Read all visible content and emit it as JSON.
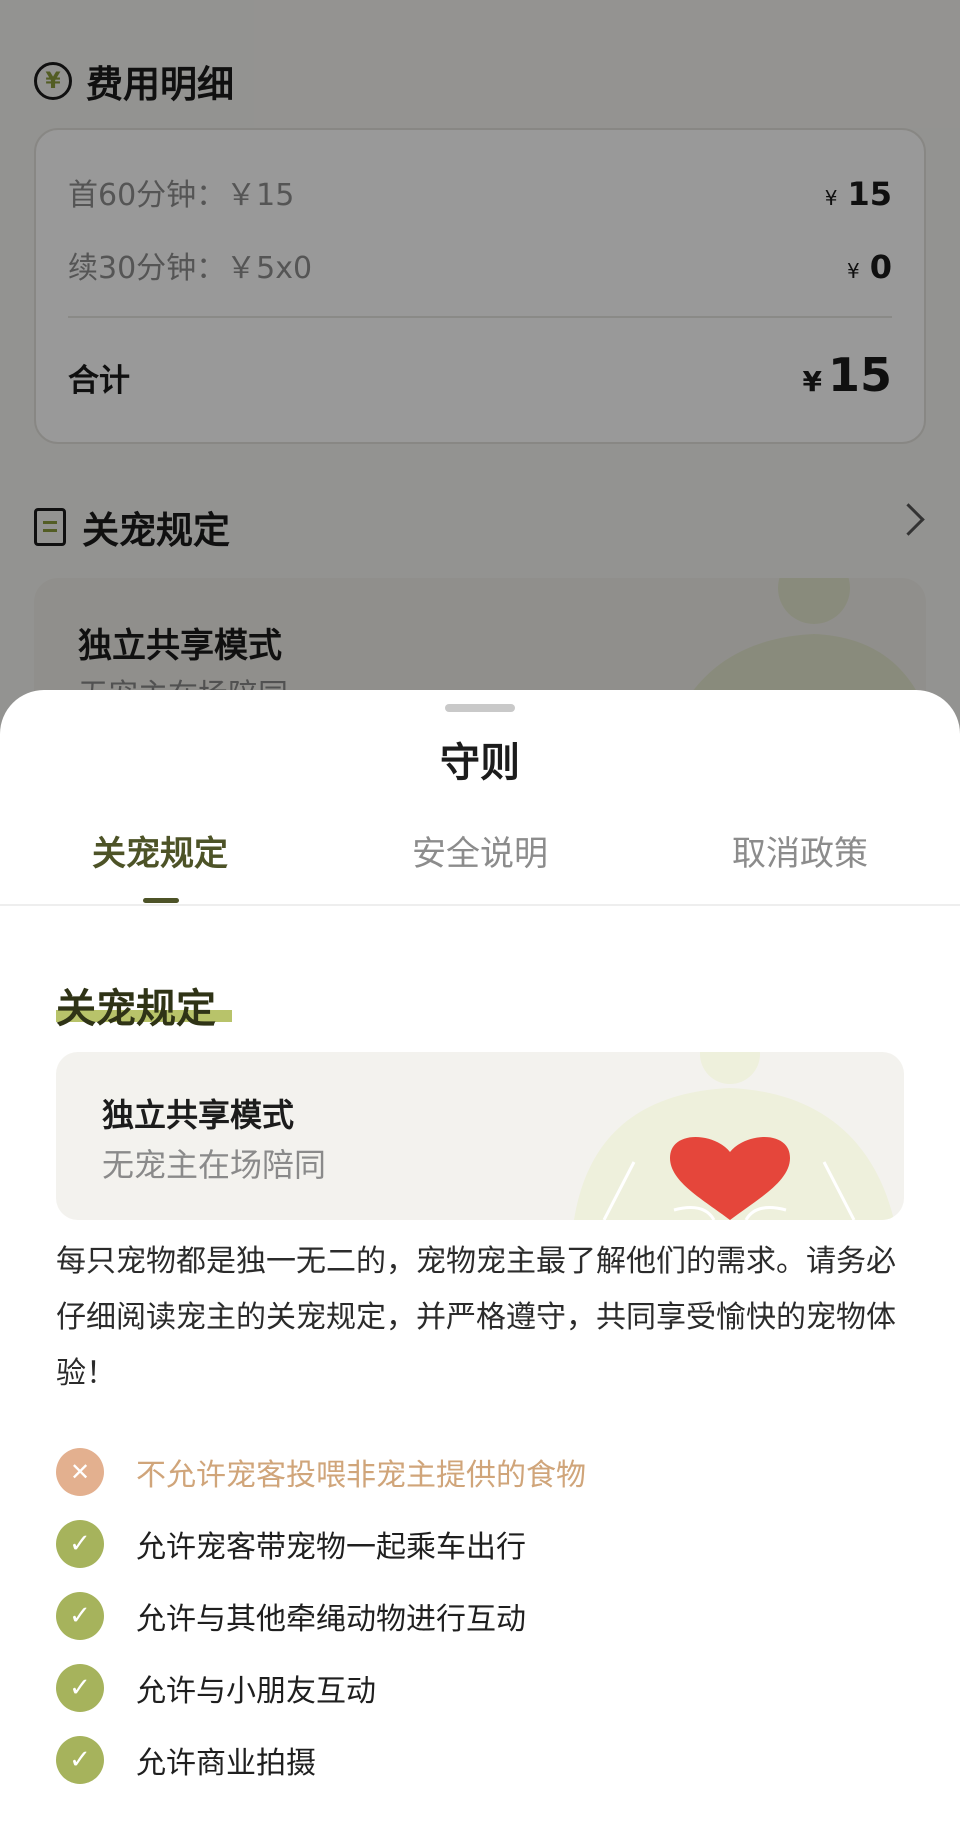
{
  "background_page": {
    "fee_section": {
      "title": "费用明细",
      "icon": "yen-circle-icon",
      "rows": [
        {
          "label": "首60分钟：￥15",
          "currency": "¥",
          "amount": "15"
        },
        {
          "label": "续30分钟：￥5x0",
          "currency": "¥",
          "amount": "0"
        }
      ],
      "total_label": "合计",
      "total_currency": "¥",
      "total_amount": "15"
    },
    "rules_section": {
      "title": "关宠规定",
      "icon": "clipboard-icon",
      "card_title": "独立共享模式",
      "card_sub": "无宠主在场陪同"
    }
  },
  "sheet": {
    "title": "守则",
    "tabs": [
      {
        "label": "关宠规定",
        "active": true
      },
      {
        "label": "安全说明",
        "active": false
      },
      {
        "label": "取消政策",
        "active": false
      }
    ],
    "heading": "关宠规定",
    "mode_card": {
      "title": "独立共享模式",
      "subtitle": "无宠主在场陪同"
    },
    "intro": "每只宠物都是独一无二的，宠物宠主最了解他们的需求。请务必仔细阅读宠主的关宠规定，并严格遵守，共同享受愉快的宠物体验！",
    "rules": [
      {
        "text": "不允许宠客投喂非宠主提供的食物",
        "allowed": false,
        "icon": "cross-icon"
      },
      {
        "text": "允许宠客带宠物一起乘车出行",
        "allowed": true,
        "icon": "check-icon"
      },
      {
        "text": "允许与其他牵绳动物进行互动",
        "allowed": true,
        "icon": "check-icon"
      },
      {
        "text": "允许与小朋友互动",
        "allowed": true,
        "icon": "check-icon"
      },
      {
        "text": "允许商业拍摄",
        "allowed": true,
        "icon": "check-icon"
      }
    ]
  },
  "colors": {
    "accent_olive": "#4d5327",
    "check_green": "#a6b35c",
    "deny_peach": "#e3b08f",
    "heart_red": "#e5463b"
  }
}
